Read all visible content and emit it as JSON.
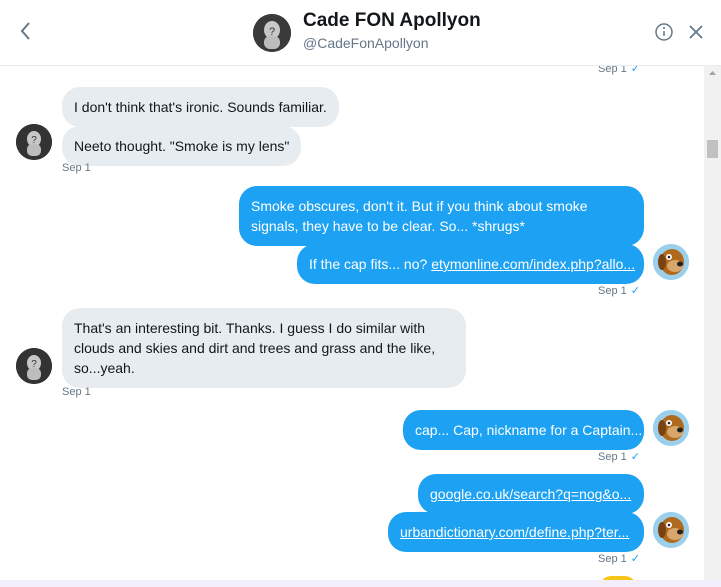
{
  "header": {
    "title": "Cade FON Apollyon",
    "handle": "@CadeFonApollyon"
  },
  "messages": [
    {
      "dir": "out",
      "meta": "Sep 1",
      "meta_check": "✓"
    },
    {
      "dir": "in",
      "text": "I don't think that's ironic. Sounds familiar."
    },
    {
      "dir": "in",
      "text": "Neeto thought. \"Smoke is my lens\"",
      "meta": "Sep 1"
    },
    {
      "dir": "out",
      "text": "Smoke obscures, don't it. But if you think about smoke signals, they have to be clear. So... *shrugs*"
    },
    {
      "dir": "out",
      "text_prefix": "If the cap fits... no? ",
      "link": "etymonline.com/index.php?allo...",
      "meta": "Sep 1",
      "meta_check": "✓"
    },
    {
      "dir": "in",
      "text": "That's an interesting bit. Thanks. I guess I do similar with clouds and skies and dirt and trees and grass and the like, so...yeah.",
      "meta": "Sep 1"
    },
    {
      "dir": "out",
      "text": "cap... Cap, nickname for a Captain...",
      "meta": "Sep 1",
      "meta_check": "✓"
    },
    {
      "dir": "out",
      "link": "google.co.uk/search?q=nog&o..."
    },
    {
      "dir": "out",
      "link": "urbandictionary.com/define.php?ter...",
      "meta": "Sep 1",
      "meta_check": "✓"
    }
  ],
  "colors": {
    "accent": "#1da1f2",
    "incoming_bubble": "#e6ecf0",
    "meta_text": "#657786"
  }
}
